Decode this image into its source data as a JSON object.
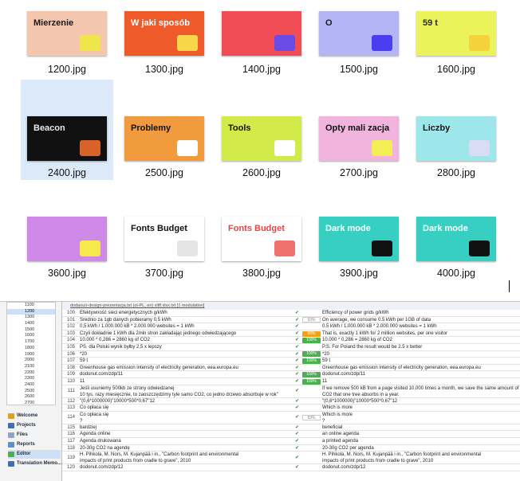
{
  "files": [
    {
      "name": "1200.jpg",
      "thumb": {
        "bg": "#f4c6ad",
        "accent": "#efe54d",
        "text": "Mierzenie",
        "text_color": "#1a1a1a"
      }
    },
    {
      "name": "1300.jpg",
      "thumb": {
        "bg": "#ef5a2b",
        "accent": "#f7d64a",
        "text": "W jaki sposób",
        "text_color": "#ffffff"
      }
    },
    {
      "name": "1400.jpg",
      "thumb": {
        "bg": "#f04d56",
        "accent": "#6b4be6",
        "text": "",
        "text_color": "#ffffff"
      }
    },
    {
      "name": "1500.jpg",
      "thumb": {
        "bg": "#b3b5f4",
        "accent": "#4a3ef0",
        "text": "O",
        "text_color": "#1a1a1a"
      }
    },
    {
      "name": "1600.jpg",
      "thumb": {
        "bg": "#eaf35a",
        "accent": "#f5d23c",
        "text": "59 t",
        "text_color": "#2a2a2a"
      }
    },
    {
      "name": "2400.jpg",
      "thumb": {
        "bg": "#111111",
        "accent": "#d8632a",
        "text": "Beacon",
        "text_color": "#e8e8e8"
      },
      "selected": true
    },
    {
      "name": "2500.jpg",
      "thumb": {
        "bg": "#f19a3e",
        "accent": "#ffffff",
        "text": "Problemy",
        "text_color": "#111111"
      }
    },
    {
      "name": "2600.jpg",
      "thumb": {
        "bg": "#d3ea4b",
        "accent": "#ffffff",
        "text": "Tools",
        "text_color": "#111111"
      }
    },
    {
      "name": "2700.jpg",
      "thumb": {
        "bg": "#f1b4dc",
        "accent": "#f4ee55",
        "text": "Opty mali zacja",
        "text_color": "#111111"
      }
    },
    {
      "name": "2800.jpg",
      "thumb": {
        "bg": "#9de6e9",
        "accent": "#d8dcf5",
        "text": "Liczby",
        "text_color": "#1a1a1a"
      }
    },
    {
      "name": "3600.jpg",
      "thumb": {
        "bg": "#cf89e6",
        "accent": "#f5e94b",
        "text": "",
        "text_color": "#111111"
      }
    },
    {
      "name": "3700.jpg",
      "thumb": {
        "bg": "#ffffff",
        "accent": "#e5e5e5",
        "text": "Fonts Budget",
        "text_color": "#111111"
      }
    },
    {
      "name": "3800.jpg",
      "thumb": {
        "bg": "#ffffff",
        "accent": "#f06f6f",
        "text": "Fonts Budget",
        "text_color": "#e04848"
      }
    },
    {
      "name": "3900.jpg",
      "thumb": {
        "bg": "#37cfc2",
        "accent": "#111111",
        "text": "Dark mode",
        "text_color": "#ffffff"
      }
    },
    {
      "name": "4000.jpg",
      "thumb": {
        "bg": "#37cfc2",
        "accent": "#111111",
        "text": "Dark mode",
        "text_color": "#ffffff"
      }
    }
  ],
  "editor": {
    "tab": "dodanuir-design-prezentacja.txt (ol-PL, en) xliff.xlsx.txt [1 modulation]",
    "file_list": [
      "1100",
      "1200",
      "1300",
      "1400",
      "1500",
      "1600",
      "1700",
      "1800",
      "1900",
      "2000",
      "2100",
      "2200",
      "2300",
      "2400",
      "2500",
      "2600",
      "2700"
    ],
    "file_list_active": "1200",
    "nav": [
      {
        "label": "Welcome",
        "color": "#e0a019"
      },
      {
        "label": "Projects",
        "color": "#3d6fb3"
      },
      {
        "label": "Files",
        "color": "#8aa7c9"
      },
      {
        "label": "Reports",
        "color": "#5b8fd6"
      },
      {
        "label": "Editor",
        "color": "#4caf50",
        "active": true
      },
      {
        "label": "Translation Memo...",
        "color": "#3d6fb3"
      }
    ],
    "rows": [
      {
        "num": "100",
        "src": [
          "Efektywność sieci energetycznych g/kWh"
        ],
        "status": "",
        "tgt": [
          "Efficiency of power grids g/kWh"
        ]
      },
      {
        "num": "101",
        "src": [
          "Średnio za 1gb danych pobieramy 0,5 kWh"
        ],
        "status": "93%",
        "tgt": [
          "On average, we consume 0.5 kWh per 1GB of data"
        ]
      },
      {
        "num": "102",
        "src": [
          "0,5 kWh / 1.000.000 kB * 2.000.000 websites = 1 kWh"
        ],
        "status": "",
        "tgt": [
          "0.5 kWh / 1.000.000 kB * 2.000.000 websites = 1 kWh"
        ]
      },
      {
        "num": "103",
        "src": [
          "Czyli dokładnie 1 kWh dla 2mln stron zakładając jednego odwiedzającego"
        ],
        "status": "99%",
        "tgt": [
          "That is, exactly 1 kWh for 2 million websites, per one visitor"
        ]
      },
      {
        "num": "104",
        "src": [
          "10.000 * 0,286 = 2860 kg of CO2"
        ],
        "status": "100%",
        "tgt": [
          "10.000 * 0,286 = 2860 kg of CO2"
        ]
      },
      {
        "num": "105",
        "src": [
          "PS. dla Polski wynik byłby 2,5 x lepszy"
        ],
        "status": "",
        "tgt": [
          "P.S. For Poland the result would be 2.5 x better"
        ]
      },
      {
        "num": "106",
        "src": [
          "*20"
        ],
        "status": "100%",
        "tgt": [
          "*20"
        ]
      },
      {
        "num": "107",
        "src": [
          "59 t"
        ],
        "status": "100%",
        "tgt": [
          "59 t"
        ]
      },
      {
        "num": "108",
        "src": [
          "Greenhouse gas emission intensity of electricity generation,   eea.europa.eu"
        ],
        "status": "",
        "tgt": [
          "Greenhouse gas emission intensity of electricity generation,   eea.europa.eu"
        ]
      },
      {
        "num": "109",
        "src": [
          "dodonut.com/zdp/11"
        ],
        "status": "100%",
        "tgt": [
          "dodonut.com/zdp/11"
        ]
      },
      {
        "num": "110",
        "src": [
          "11"
        ],
        "status": "100%",
        "tgt": [
          "11"
        ]
      },
      {
        "num": "111",
        "src": [
          "Jeśli usuniemy 500kb ze strony odwiedzanej",
          "10 tys. razy miesięcznie, to zaoszczędzimy tyle samo CO2, co jedno drzewo absorbuje w rok\""
        ],
        "status": "",
        "tgt": [
          "If we remove 500 kB from a page visited 10,000 times a month, we save the same amount of",
          "CO2 that one tree absorbs in a year."
        ]
      },
      {
        "num": "112",
        "src": [
          "\"(0,6*1000000)\"10000*500*0,67\"12"
        ],
        "status": "",
        "tgt": [
          "\"(0,6*1000000)\"10000*500*0,67\"12"
        ]
      },
      {
        "num": "113",
        "src": [
          "Co opłaca się"
        ],
        "status": "",
        "tgt": [
          "Which is more"
        ]
      },
      {
        "num": "114",
        "src": [
          "Co opłaca się",
          "?"
        ],
        "status": "83%",
        "tgt": [
          "Which is more",
          "?"
        ]
      },
      {
        "num": "115",
        "src": [
          "bardziej"
        ],
        "status": "",
        "tgt": [
          "beneficial"
        ]
      },
      {
        "num": "116",
        "src": [
          "Agenda online"
        ],
        "status": "",
        "tgt": [
          "an online agenda"
        ]
      },
      {
        "num": "117",
        "src": [
          "Agenda drukowana"
        ],
        "status": "",
        "tgt": [
          "a printed agenda"
        ]
      },
      {
        "num": "118",
        "src": [
          "20-30g CO2 na agendę"
        ],
        "status": "",
        "tgt": [
          "20-30g CO2 per agenda"
        ]
      },
      {
        "num": "119",
        "src": [
          "H. Pihkola, M. Nors, M. Kujanpää i in., \"Carbon   footprint   and   environmental",
          "impacts   of   print   products   from   cradle   to   grave\", 2010"
        ],
        "status": "",
        "tgt": [
          "H. Pihkola, M. Nors, M. Kujanpää i in., \"Carbon   footprint   and   environmental",
          "impacts   of   print   products   from   cradle   to   grave\", 2010"
        ]
      },
      {
        "num": "120",
        "src": [
          "dodonut.com/zdp/12"
        ],
        "status": "",
        "tgt": [
          "dodonut.com/zdp/12"
        ]
      }
    ]
  }
}
